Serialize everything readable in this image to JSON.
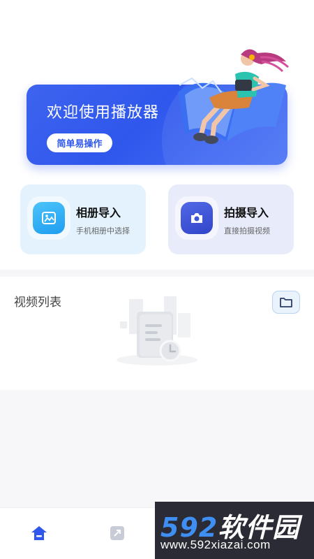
{
  "banner": {
    "title": "欢迎使用播放器",
    "button_label": "简单易操作"
  },
  "actions": [
    {
      "title": "相册导入",
      "subtitle": "手机相册中选择",
      "icon": "image-icon"
    },
    {
      "title": "拍摄导入",
      "subtitle": "直接拍摄视频",
      "icon": "camera-icon"
    }
  ],
  "video_list": {
    "title": "视频列表",
    "folder_icon": "folder-icon",
    "empty_icon": "empty-document-icon"
  },
  "bottom_nav": [
    {
      "icon": "home-icon",
      "active": true
    },
    {
      "icon": "edit-icon",
      "active": false
    }
  ],
  "watermark": {
    "number": "592",
    "text": "软件园",
    "url": "www.592xiazai.com"
  },
  "colors": {
    "accent": "#2f57ec",
    "album_card_bg": "#e3f2fd",
    "shoot_card_bg": "#e8ebfa",
    "watermark_blue": "#3f8ff3"
  }
}
